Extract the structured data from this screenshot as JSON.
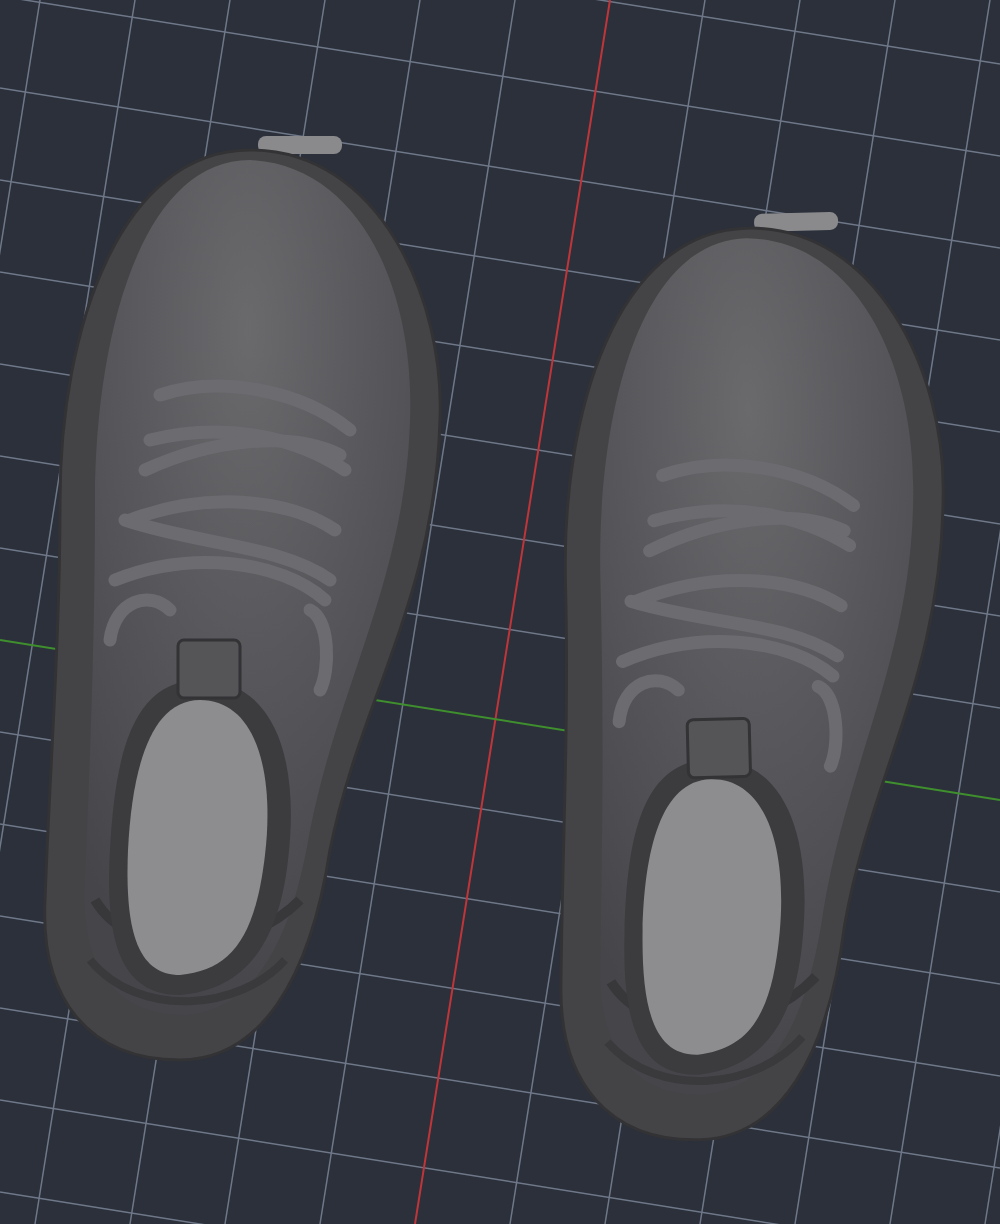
{
  "viewport": {
    "kind": "grid",
    "objects": [
      {
        "kind": "shoe"
      },
      {
        "kind": "shoe"
      }
    ]
  }
}
